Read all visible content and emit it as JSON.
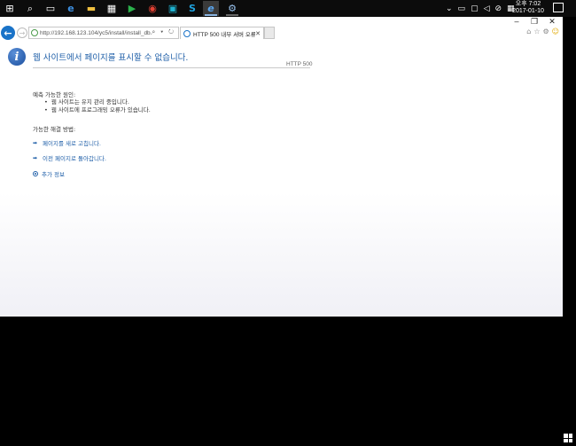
{
  "taskbar": {
    "icons": [
      "windows-start-icon",
      "search-icon",
      "task-view-icon",
      "edge-icon",
      "file-explorer-icon",
      "store-icon",
      "media-player-icon",
      "chrome-icon",
      "app-icon",
      "skype-icon",
      "ie-icon",
      "network-app-icon"
    ],
    "clock": {
      "time": "오후 7:02",
      "date": "2017-01-10"
    }
  },
  "window": {
    "controls": {
      "minimize": "–",
      "restore": "❐",
      "close": "✕"
    }
  },
  "browser": {
    "url": "http://192.168.123.104/yc5/install/install_db.php",
    "address_icons": "⌕ ▾ ↻",
    "tab_title": "HTTP 500 내부 서버 오류",
    "tab_close": "✕"
  },
  "error_page": {
    "title": "웹 사이트에서 페이지를 표시할 수 없습니다.",
    "code": "HTTP 500",
    "causes_heading": "예측 가능한 원인:",
    "causes": [
      "웹 사이트는 유지 관리 중입니다.",
      "웹 사이트에 프로그래밍 오류가 있습니다."
    ],
    "solutions_heading": "가능한 해결 방법:",
    "refresh_label": "페이지를 새로 고칩니다.",
    "back_label": "이전 페이지로 돌아갑니다.",
    "more_info_label": "추가 정보"
  },
  "colors": {
    "accent": "#1f5fa8",
    "back_button": "#1a73c8"
  }
}
